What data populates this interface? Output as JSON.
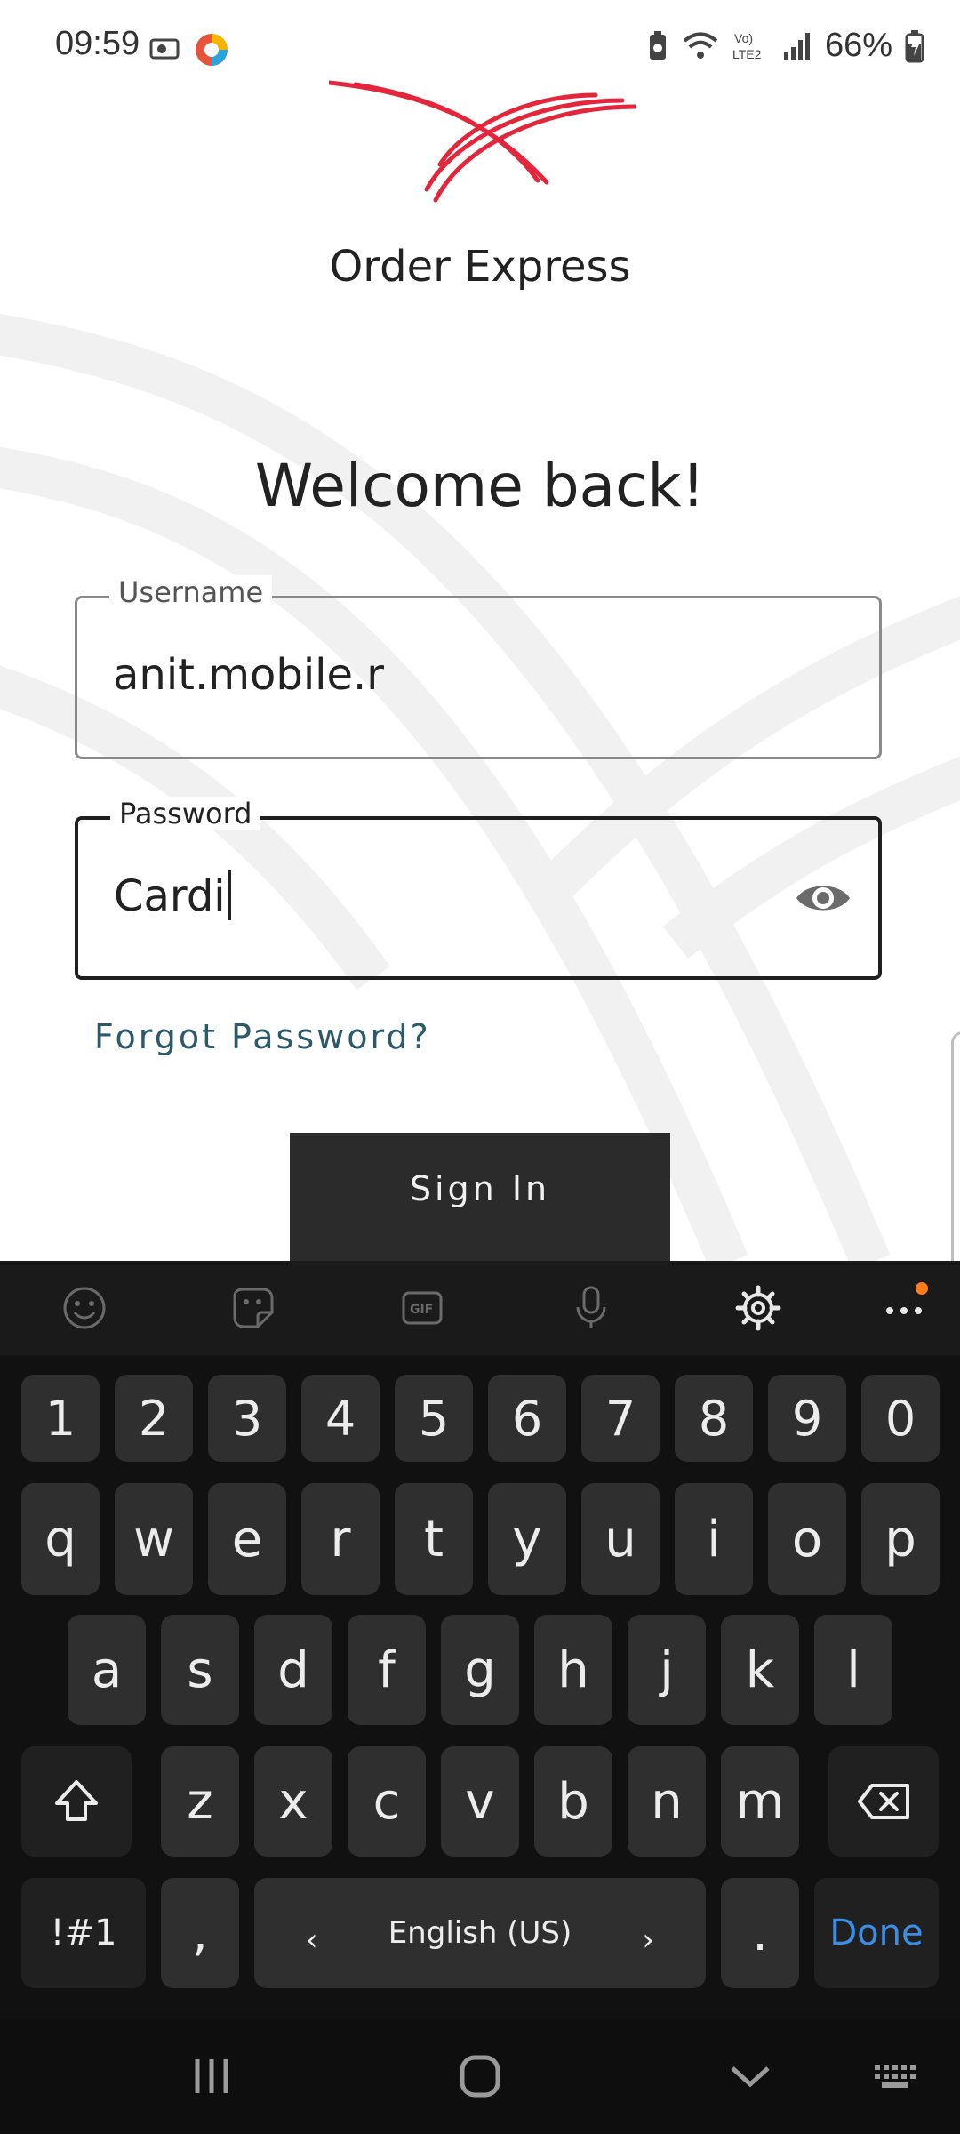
{
  "status_bar": {
    "time": "09:59",
    "battery_pct": "66%",
    "network_label": "Vo) LTE2"
  },
  "app": {
    "brand_name": "Order Express",
    "brand_color": "#e3263b"
  },
  "login": {
    "welcome": "Welcome back!",
    "username_label": "Username",
    "username_value": "anit.mobile.r",
    "password_label": "Password",
    "password_value": "Cardi",
    "forgot_password": "Forgot Password?",
    "sign_in": "Sign In"
  },
  "keyboard": {
    "toolbar_icons": [
      "emoji-icon",
      "sticker-icon",
      "gif-icon",
      "microphone-icon",
      "settings-icon",
      "more-icon"
    ],
    "row_numbers": [
      "1",
      "2",
      "3",
      "4",
      "5",
      "6",
      "7",
      "8",
      "9",
      "0"
    ],
    "row_top": [
      "q",
      "w",
      "e",
      "r",
      "t",
      "y",
      "u",
      "i",
      "o",
      "p"
    ],
    "row_middle": [
      "a",
      "s",
      "d",
      "f",
      "g",
      "h",
      "j",
      "k",
      "l"
    ],
    "row_bottom": [
      "z",
      "x",
      "c",
      "v",
      "b",
      "n",
      "m"
    ],
    "symbols_key": "!#1",
    "comma_key": ",",
    "space_label": "English (US)",
    "period_key": ".",
    "done_key": "Done",
    "done_color": "#3b8ee6"
  },
  "navbar": {
    "icons": [
      "recent-apps-icon",
      "home-icon",
      "hide-keyboard-icon",
      "keyboard-switch-icon"
    ]
  }
}
